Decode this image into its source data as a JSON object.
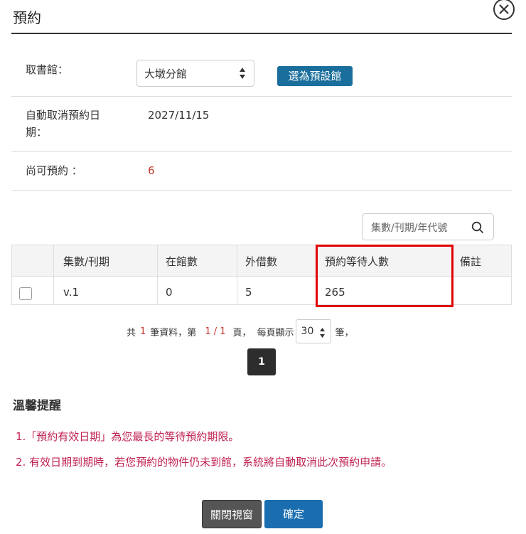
{
  "dialog": {
    "title": "預約",
    "close_icon": "close-icon"
  },
  "pickup": {
    "label": "取書館：",
    "selected": "大墩分館",
    "set_default_label": "選為預設館"
  },
  "auto_cancel": {
    "label_line1": "自動取消預約日",
    "label_line2": "期：",
    "value": "2027/11/15"
  },
  "remaining": {
    "label": "尚可預約 ：",
    "value": "6"
  },
  "search": {
    "placeholder": "集數/刊期/年代號",
    "icon": "search-icon"
  },
  "table": {
    "headers": [
      "集數/刊期",
      "在館數",
      "外借數",
      "預約等待人數",
      "備註"
    ],
    "rows": [
      {
        "volume": "v.1",
        "in_library": "0",
        "on_loan": "5",
        "waiting": "265",
        "note": ""
      }
    ]
  },
  "pager": {
    "prefix": "共",
    "total": "1",
    "records_text": "筆資料，第",
    "current": "1 / 1",
    "page_text": "頁，",
    "per_page_text": "每頁顯示",
    "per_page": "30",
    "suffix": "筆，",
    "page_button": "1"
  },
  "notice": {
    "title": "溫馨提醒",
    "items": [
      "1.「預約有效日期」為您最長的等待預約期限。",
      "2. 有效日期到期時，若您預約的物件仍未到館，系統將自動取消此次預約申請。"
    ]
  },
  "footer": {
    "close_label": "關閉視窗",
    "ok_label": "確定"
  },
  "colors": {
    "primary_button": "#1a6eb0",
    "highlight_border": "#e10000",
    "notice_text": "#c0224f",
    "value_red": "#c0392b"
  }
}
